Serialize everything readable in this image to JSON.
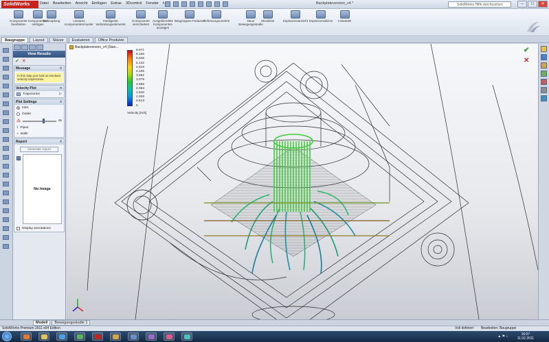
{
  "app": {
    "logo": "SolidWorks",
    "menu": [
      "Datei",
      "Bearbeiten",
      "Ansicht",
      "Einfügen",
      "Extras",
      "3Dcontrol",
      "Fenster",
      "Hilfe"
    ],
    "doc_title": "Backplateversion_v4 *",
    "help_placeholder": "SolidWorks Hilfe durchsuchen"
  },
  "ribbon": {
    "buttons": [
      "Komponente bearbeiten",
      "Komponenten einfügen",
      "Verknüpfung",
      "Lineares Komponentenmuster",
      "Intelligente Verbindungselemente",
      "Komponente verschieben",
      "Ausgeblendete Komponenten anzeigen",
      "Baugruppen-Features",
      "Referenzgeometrie",
      "Neue Bewegungsstudie",
      "Stückliste",
      "Explosionsansicht",
      "Explosionsskizze",
      "Instant3D"
    ]
  },
  "tabs": [
    "Baugruppe",
    "Layout",
    "Skizze",
    "Evaluieren",
    "Office Produkte"
  ],
  "panel": {
    "title": "View Results",
    "ok": "✔",
    "cancel": "✕",
    "message_header": "Message",
    "message": "In this step you look at resultant velocity trajectories.",
    "velocity_header": "Velocity Plot",
    "velocity_item": "Trajectories",
    "settings_header": "Plot Settings",
    "inlet": "Inlet",
    "outlet": "Outlet",
    "slider_value": "45",
    "pipes": "Pipes",
    "balls": "Balls",
    "report_header": "Report",
    "generate": "Generate report",
    "no_image": "No Image",
    "display_annotations": "Display annotations"
  },
  "viewport": {
    "tree_node": "Backplateversion_v4 (Stan...",
    "legend_values": [
      "6.671",
      "6.158",
      "5.645",
      "5.132",
      "4.619",
      "4.106",
      "3.592",
      "3.079",
      "2.566",
      "2.053",
      "1.540",
      "1.026",
      "0.513",
      "0"
    ],
    "legend_unit": "Velocity [m/s]",
    "legend_colors": [
      "#e0001b",
      "#ffd500",
      "#1fcf2f",
      "#0098e8",
      "#0020d8"
    ],
    "flow_color": "#3fcc3a"
  },
  "bottom_tabs": [
    "Modell",
    "Bewegungsstudie 1"
  ],
  "status": {
    "left": "SolidWorks Premium 2011 x64 Edition",
    "state": "Voll definiert",
    "mode": "Bearbeiten: Baugruppe"
  },
  "taskbar": {
    "time": "16:07",
    "date": "11.02.2011"
  }
}
